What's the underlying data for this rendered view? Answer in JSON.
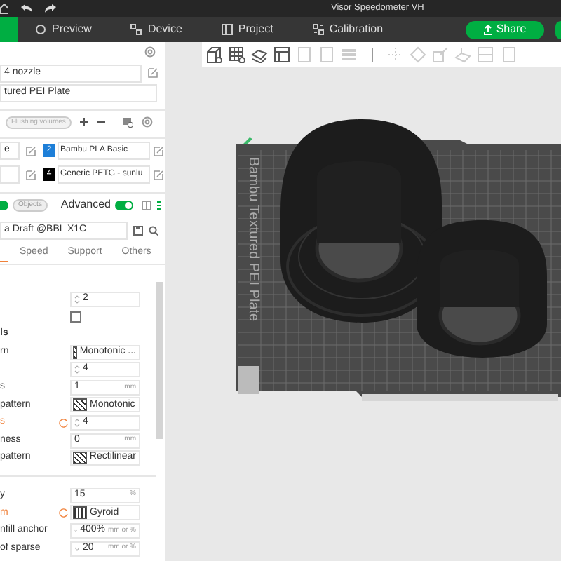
{
  "title_bar": {
    "title": "Visor Speedometer VH"
  },
  "tabs": [
    {
      "kind": "cut",
      "selected": true
    },
    {
      "kind": "preview",
      "label": "Preview",
      "selected": false
    },
    {
      "kind": "device",
      "label": "Device",
      "selected": false
    },
    {
      "kind": "project",
      "label": "Project",
      "selected": false
    },
    {
      "kind": "calibration",
      "label": "Calibration",
      "selected": false
    }
  ],
  "share_button": {
    "label": "Share"
  },
  "printer": {
    "nozzle": "4 nozzle",
    "plate": "tured PEI Plate"
  },
  "flushing_button": {
    "label": "Flushing volumes",
    "disabled": true
  },
  "filaments": [
    {
      "field": "e",
      "slot": "2",
      "color": "#1e7fd8",
      "name": "Bambu PLA Basic"
    },
    {
      "slot": "4",
      "color": "#000000",
      "name": "Generic PETG - sunlu"
    }
  ],
  "mode": {
    "objects_label": "Objects",
    "objects_on": true,
    "advanced_label": "Advanced",
    "advanced_on": true
  },
  "process_preset": "a Draft @BBL X1C",
  "setting_tabs": [
    {
      "selected": true
    },
    {
      "label": "Speed",
      "selected": false
    },
    {
      "label": "Support",
      "selected": false
    },
    {
      "label": "Others",
      "selected": false
    }
  ],
  "settings": [
    {
      "kind": "spin",
      "value": "2",
      "modified": false
    },
    {
      "kind": "checkbox",
      "checked": false
    },
    {
      "kind": "heading",
      "label": "ls"
    },
    {
      "kind": "pattern",
      "label": "rn",
      "value": "Monotonic ...",
      "modified": false
    },
    {
      "kind": "spin",
      "value": "4",
      "modified": false
    },
    {
      "kind": "number",
      "label": "s",
      "value": "1",
      "unit": "mm",
      "modified": false
    },
    {
      "kind": "pattern",
      "label": "pattern",
      "value": "Monotonic",
      "modified": false
    },
    {
      "kind": "spin",
      "label": "s",
      "value": "4",
      "modified": true
    },
    {
      "kind": "number",
      "label": "ness",
      "value": "0",
      "unit": "mm",
      "modified": false
    },
    {
      "kind": "pattern",
      "label": "pattern",
      "value": "Rectilinear",
      "modified": false
    },
    {
      "kind": "gap"
    },
    {
      "kind": "number",
      "label": "y",
      "value": "15",
      "unit": "%",
      "modified": false
    },
    {
      "kind": "pattern",
      "label": "m",
      "value": "Gyroid",
      "modified": true
    },
    {
      "kind": "combo",
      "label": "nfill anchor",
      "value": "400%",
      "unit": "mm or %",
      "modified": false
    },
    {
      "kind": "combo",
      "label": "of sparse",
      "value": "20",
      "unit": "mm or %",
      "modified": false
    }
  ],
  "plate": {
    "label": "Bambu Textured PEI Plate"
  }
}
